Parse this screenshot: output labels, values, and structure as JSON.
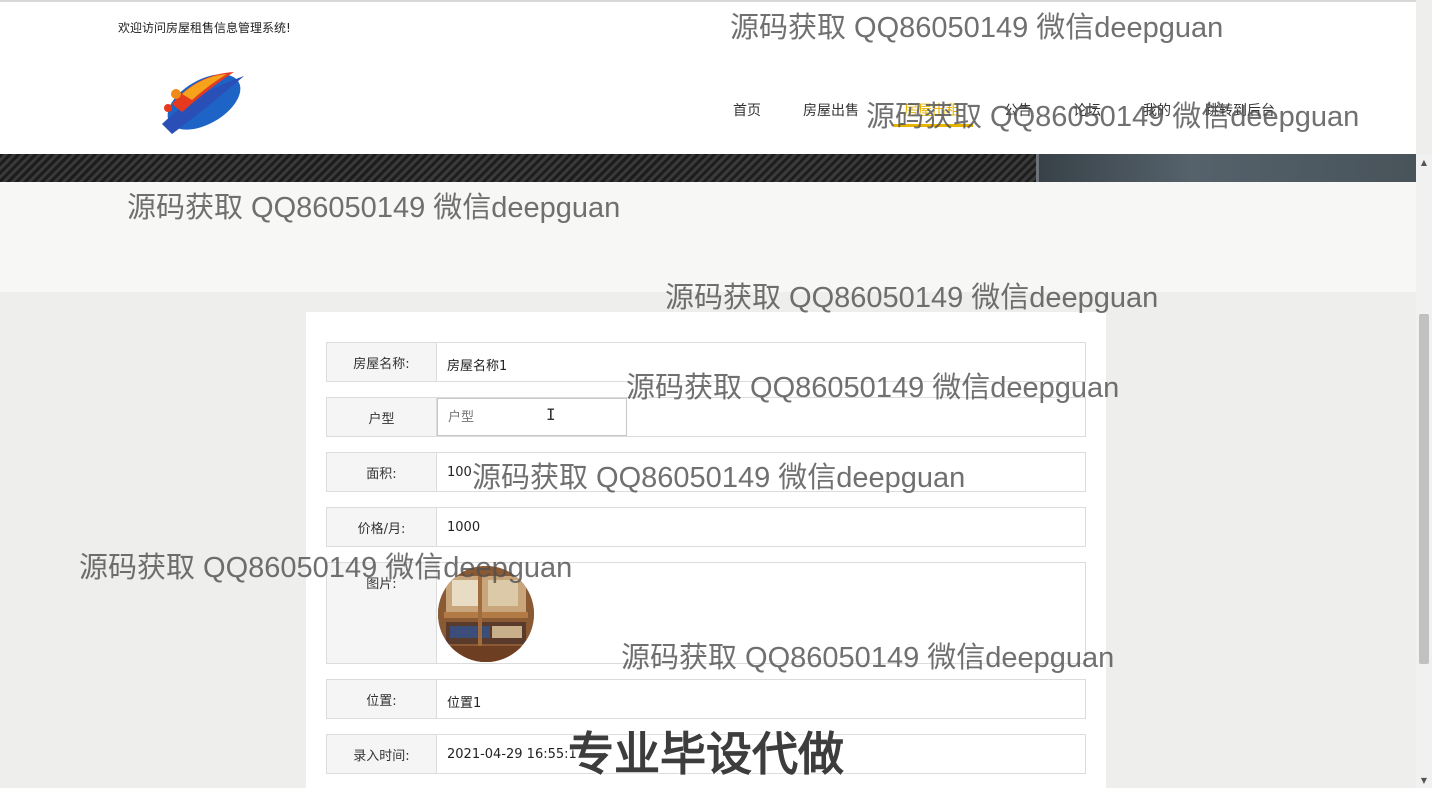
{
  "header": {
    "welcome": "欢迎访问房屋租售信息管理系统!"
  },
  "nav": {
    "items": [
      {
        "label": "首页"
      },
      {
        "label": "房屋出售"
      },
      {
        "label": "房屋出租"
      },
      {
        "label": "公告"
      },
      {
        "label": "论坛"
      },
      {
        "label": "我的"
      },
      {
        "label": "跳转到后台"
      }
    ],
    "active_index": 2,
    "accent_color": "#e8b400"
  },
  "form": {
    "rows": [
      {
        "label": "房屋名称:",
        "value": "房屋名称1"
      },
      {
        "label": "户型",
        "placeholder": "户型"
      },
      {
        "label": "面积:",
        "value": "100"
      },
      {
        "label": "价格/月:",
        "value": "1000"
      },
      {
        "label": "图片:",
        "image": "bunk-bed-room-photo"
      },
      {
        "label": "位置:",
        "value": "位置1"
      },
      {
        "label": "录入时间:",
        "value": "2021-04-29 16:55:17"
      }
    ]
  },
  "watermarks": {
    "text": "源码获取 QQ86050149 微信deepguan",
    "big_text": "专业毕设代做"
  },
  "icons": {
    "logo": "flame-swoosh-logo",
    "cursor": "text-cursor-icon",
    "scroll_up": "scroll-up-arrow",
    "scroll_down": "scroll-down-arrow"
  }
}
